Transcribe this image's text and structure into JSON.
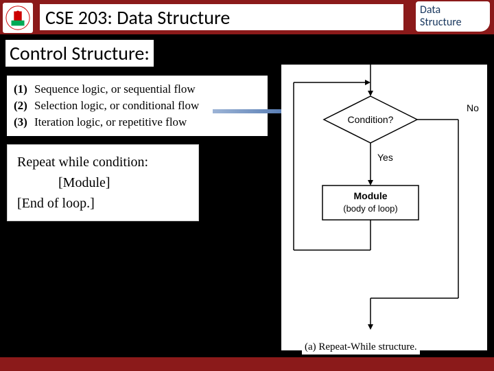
{
  "header": {
    "title": "CSE 203: Data Structure",
    "badge_line1": "Data",
    "badge_line2": "Structure"
  },
  "subtitle": "Control Structure:",
  "logic_types": [
    {
      "num": "(1)",
      "text": "Sequence logic, or sequential flow"
    },
    {
      "num": "(2)",
      "text": "Selection logic, or conditional flow"
    },
    {
      "num": "(3)",
      "text": "Iteration logic, or repetitive flow"
    }
  ],
  "pseudocode": {
    "line1": "Repeat while condition:",
    "line2": "[Module]",
    "line3": "[End of loop.]"
  },
  "flowchart": {
    "condition": "Condition?",
    "no_label": "No",
    "yes_label": "Yes",
    "module_line1": "Module",
    "module_line2": "(body of loop)"
  },
  "caption": "(a) Repeat-While structure."
}
